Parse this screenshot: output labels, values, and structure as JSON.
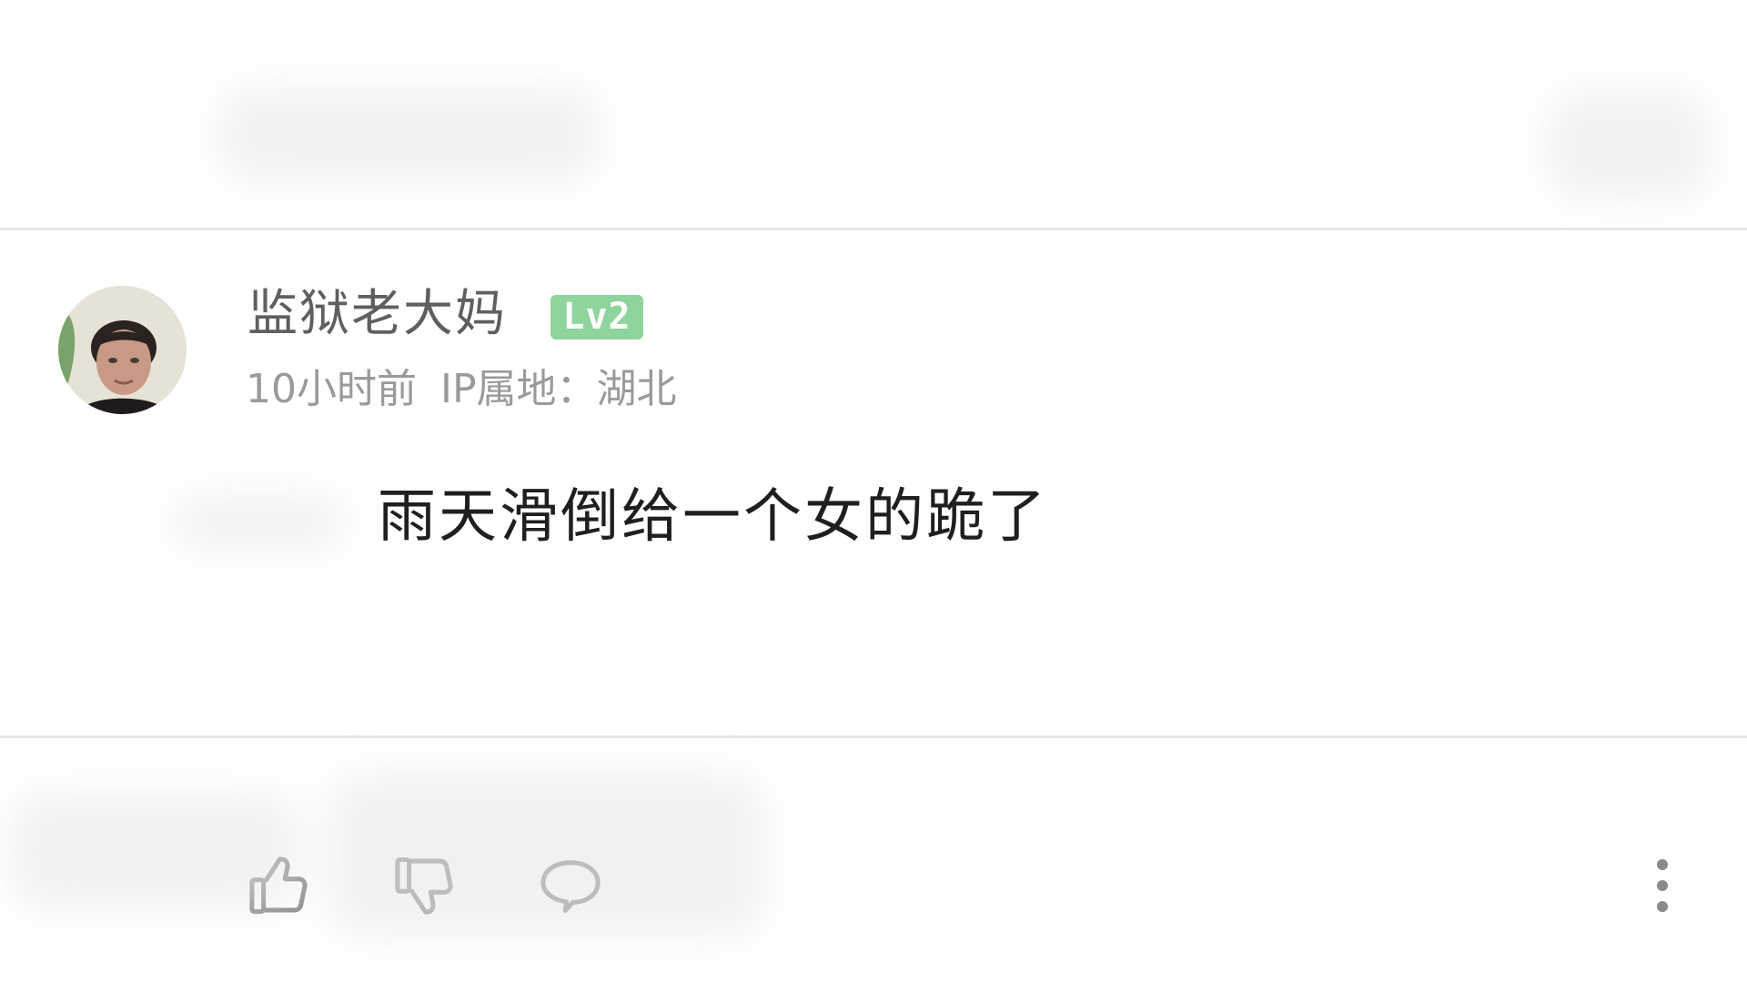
{
  "comment": {
    "username": "监狱老大妈",
    "level_badge": "Lv2",
    "time": "10小时前",
    "ip_location": "IP属地：湖北",
    "text": "雨天滑倒给一个女的跪了"
  },
  "actions": [
    {
      "name": "like",
      "icon": "thumbs-up-icon"
    },
    {
      "name": "dislike",
      "icon": "thumbs-down-icon"
    },
    {
      "name": "reply",
      "icon": "speech-bubble-icon"
    },
    {
      "name": "more",
      "icon": "more-vertical-icon"
    }
  ],
  "colors": {
    "background": "#ffffff",
    "username": "#5f5f5f",
    "meta": "#9a9a9a",
    "text": "#1f1f1f",
    "level_badge": "#8fd49c",
    "icon": "#8a8a8a",
    "divider": "#e6e6e6"
  }
}
